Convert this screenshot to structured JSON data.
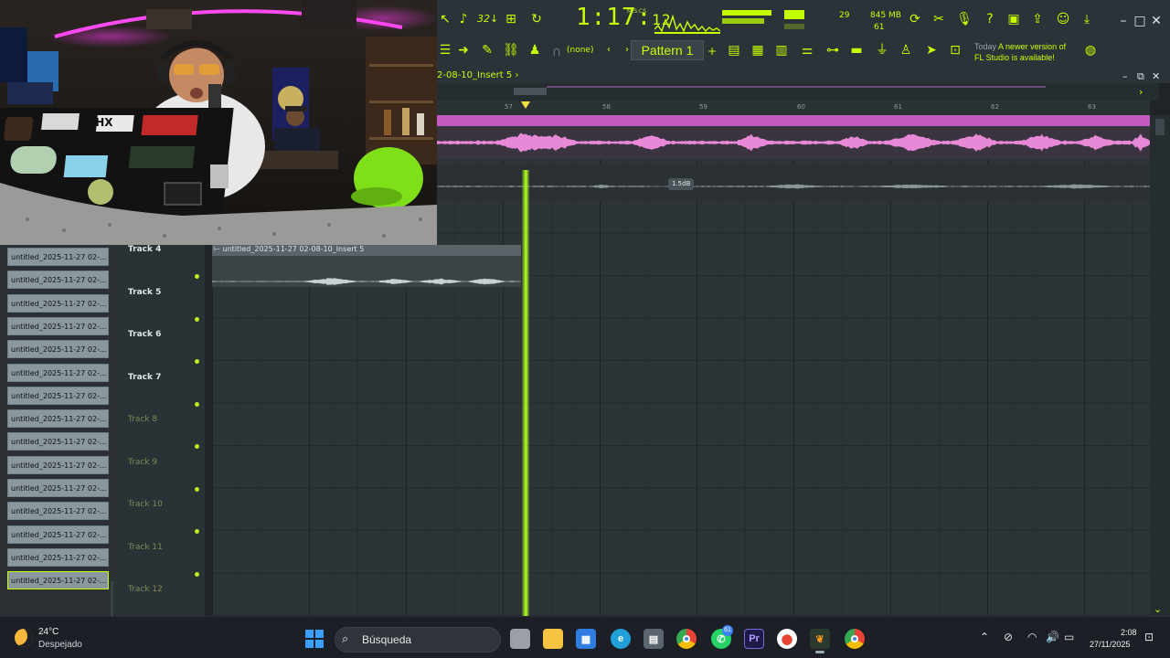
{
  "toolbar": {
    "time_main": "1:17:",
    "time_sub": "12",
    "time_unit": "M:S:CS",
    "cpu_value": "29",
    "memory": "845 MB",
    "polyphony": "61",
    "pattern_select": "(none)",
    "pattern_name": "Pattern 1",
    "news_date": "Today",
    "news_text_1": "A newer version of",
    "news_text_2": "FL Studio is available!",
    "tempo_display": "32↓"
  },
  "playlist": {
    "title": "2-08-10_Insert 5",
    "ruler": [
      "57",
      "58",
      "59",
      "60",
      "61",
      "62",
      "63"
    ],
    "db_label": "1.5dB",
    "clip_label": "untitled_2025-11-27 02-08-10_Insert 5",
    "tracks": [
      {
        "name": "Track 4",
        "dim": false
      },
      {
        "name": "Track 5",
        "dim": false
      },
      {
        "name": "Track 6",
        "dim": false
      },
      {
        "name": "Track 7",
        "dim": false
      },
      {
        "name": "Track 8",
        "dim": true
      },
      {
        "name": "Track 9",
        "dim": true
      },
      {
        "name": "Track 10",
        "dim": true
      },
      {
        "name": "Track 11",
        "dim": true
      },
      {
        "name": "Track 12",
        "dim": true
      }
    ],
    "patterns": [
      "untitled_2025-11-27 02-...",
      "untitled_2025-11-27 02-...",
      "untitled_2025-11-27 02-...",
      "untitled_2025-11-27 02-...",
      "untitled_2025-11-27 02-...",
      "untitled_2025-11-27 02-...",
      "untitled_2025-11-27 02-...",
      "untitled_2025-11-27 02-...",
      "untitled_2025-11-27 02-...",
      "untitled_2025-11-27 02-...",
      "untitled_2025-11-27 02-...",
      "untitled_2025-11-27 02-...",
      "untitled_2025-11-27 02-...",
      "untitled_2025-11-27 02-...",
      "untitled_2025-11-27 02-..."
    ]
  },
  "webcam": {
    "laptop_text": "XHX"
  },
  "taskbar": {
    "weather_temp": "24°C",
    "weather_cond": "Despejado",
    "search_placeholder": "Búsqueda",
    "time": "2:08",
    "date": "27/11/2025",
    "whatsapp_badge": "61",
    "premiere_label": "Pr"
  },
  "colors": {
    "accent": "#c6ff00",
    "waveform": "#e889d8",
    "clip_header": "#c25ac0",
    "playhead": "#8fe01a"
  }
}
